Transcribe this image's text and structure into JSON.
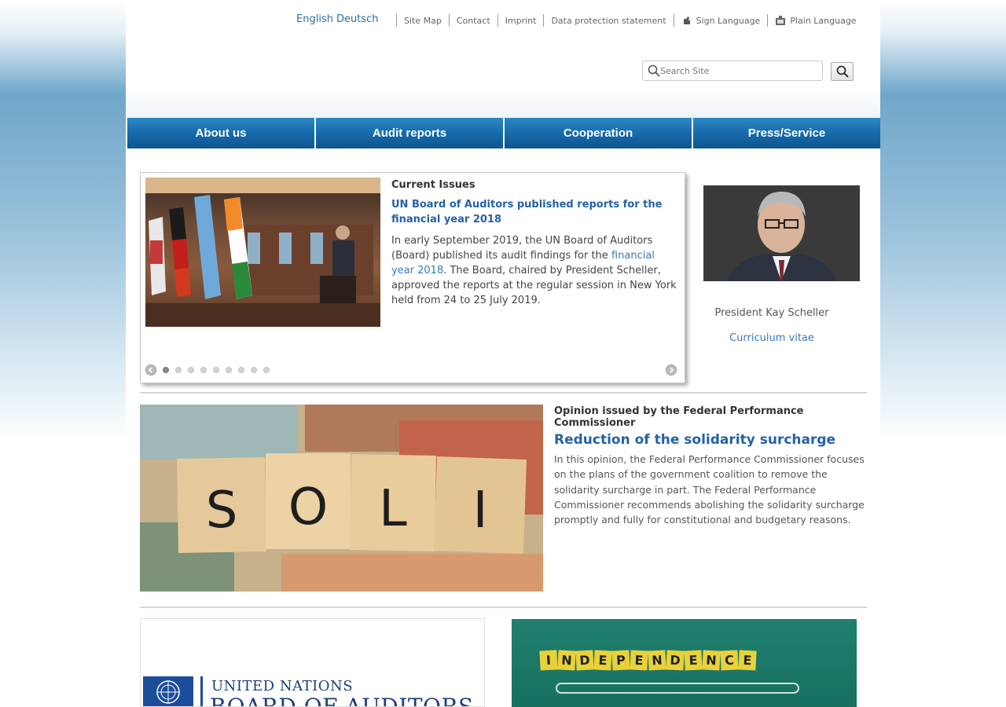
{
  "header": {
    "languages": [
      "English",
      "Deutsch"
    ],
    "links": [
      {
        "label": "Site Map",
        "icon": ""
      },
      {
        "label": "Contact",
        "icon": ""
      },
      {
        "label": "Imprint",
        "icon": ""
      },
      {
        "label": "Data protection statement",
        "icon": ""
      },
      {
        "label": "Sign Language",
        "icon": "sign-language-icon"
      },
      {
        "label": "Plain Language",
        "icon": "plain-language-icon"
      }
    ],
    "search": {
      "placeholder": "Search Site",
      "button_icon": "search-icon"
    }
  },
  "nav": {
    "items": [
      "About us",
      "Audit reports",
      "Cooperation",
      "Press/Service"
    ]
  },
  "slider": {
    "kicker": "Current Issues",
    "headline": "UN Board of Auditors published reports for the financial year 2018",
    "body_part1": "In early September 2019, the UN Board of Auditors (Board) published its audit findings for the ",
    "body_link": "financial year 2018",
    "body_part2": ". The Board, chaired by President Scheller, approved the reports at the regular session in New York held from 24 to 25 July 2019.",
    "active_slide": 1,
    "total_slides": 9
  },
  "president": {
    "name": "President Kay Scheller",
    "cv_label": "Curriculum vitae"
  },
  "teaser": {
    "kicker": "Opinion issued by the Federal Performance Commissioner",
    "headline": "Reduction of the solidarity surcharge",
    "body": "In this opinion, the Federal Performance Commissioner focuses on the plans of the government coalition to remove the solidarity surcharge in part. The Federal Performance Commissioner recommends abolishing the solidarity surcharge promptly and fully for constitutional and budgetary reasons.",
    "image_letters": [
      "S",
      "O",
      "L",
      "I"
    ]
  },
  "bottom": {
    "un_line1": "UNITED NATIONS",
    "un_line2": "BOARD OF AUDITORS",
    "independence_word": "INDEPENDENCE"
  },
  "colors": {
    "nav_blue": "#1668a8",
    "link_blue": "#2462a5",
    "un_blue": "#1c4d9b",
    "chalkboard_green": "#1f7f6e",
    "tile_yellow": "#e9d13a"
  }
}
